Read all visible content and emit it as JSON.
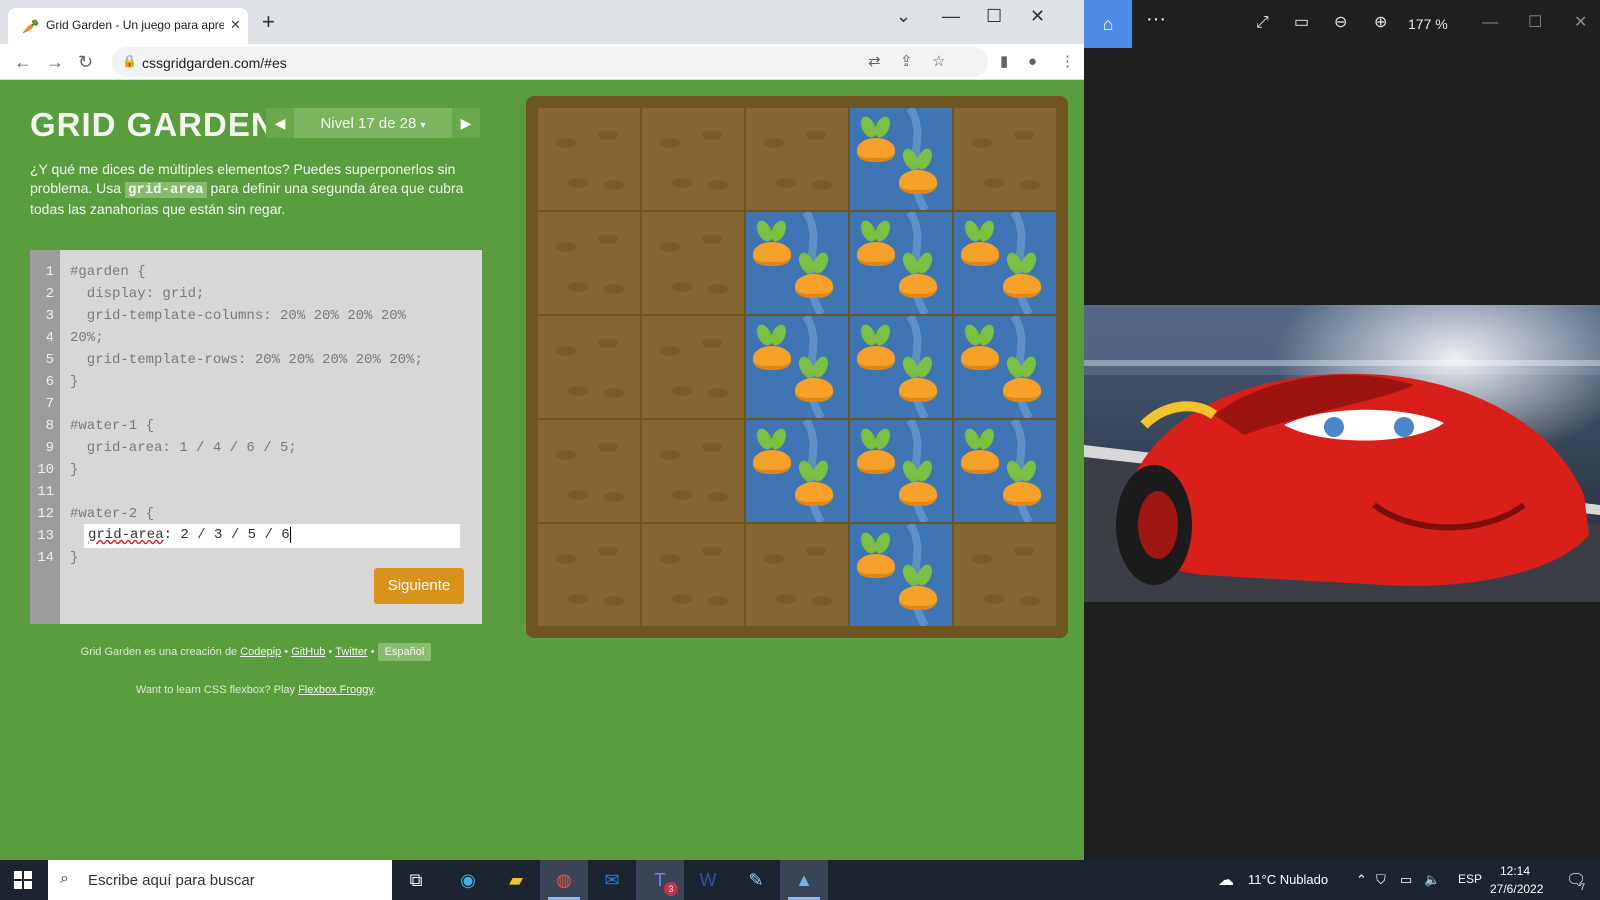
{
  "browser": {
    "tab_title": "Grid Garden - Un juego para aprender CSS grid",
    "tab_favicon": "🥕",
    "url": "cssgridgarden.com/#es"
  },
  "game": {
    "logo": "GRID GARDEN",
    "level_label": "Nivel 17 de 28",
    "instructions_before": "¿Y qué me dices de múltiples elementos? Puedes superponerlos sin problema. Usa ",
    "instructions_code": "grid-area",
    "instructions_after": " para definir una segunda área que cubra todas las zanahorias que están sin regar.",
    "code_lines": [
      "#garden {",
      "  display: grid;",
      "  grid-template-columns: 20% 20% 20% 20%",
      "20%;",
      "  grid-template-rows: 20% 20% 20% 20% 20%;",
      "}",
      "",
      "#water-1 {",
      "  grid-area: 1 / 4 / 6 / 5;",
      "}",
      "",
      "#water-2 {",
      "",
      "}"
    ],
    "line_numbers": [
      "1",
      "2",
      "3",
      "4",
      "5",
      "6",
      "7",
      "8",
      "9",
      "10",
      "11",
      "12",
      "13",
      "14"
    ],
    "answer_property": "grid-area",
    "answer_value": ": 2 / 3 / 5 / 6",
    "next_button": "Siguiente",
    "credits_prefix": "Grid Garden es una creación de ",
    "credits_codepip": "Codepip",
    "credits_github": "GitHub",
    "credits_twitter": "Twitter",
    "credits_language": "Español",
    "flexbox_prefix": "Want to learn CSS flexbox? Play ",
    "flexbox_link": "Flexbox Froggy",
    "flexbox_suffix": ".",
    "water_cells": [
      [
        0,
        3
      ],
      [
        1,
        2
      ],
      [
        1,
        3
      ],
      [
        1,
        4
      ],
      [
        2,
        2
      ],
      [
        2,
        3
      ],
      [
        2,
        4
      ],
      [
        3,
        2
      ],
      [
        3,
        3
      ],
      [
        3,
        4
      ],
      [
        4,
        3
      ]
    ],
    "carrot_cells": [
      [
        0,
        3
      ],
      [
        1,
        2
      ],
      [
        1,
        3
      ],
      [
        1,
        4
      ],
      [
        2,
        2
      ],
      [
        2,
        3
      ],
      [
        2,
        4
      ],
      [
        3,
        2
      ],
      [
        3,
        3
      ],
      [
        3,
        4
      ],
      [
        4,
        3
      ]
    ]
  },
  "photos": {
    "zoom": "177 %"
  },
  "taskbar": {
    "search_placeholder": "Escribe aquí para buscar",
    "weather": "11°C  Nublado",
    "lang": "ESP",
    "time": "12:14",
    "date": "27/6/2022",
    "notifications": "7",
    "teams_badge": "3"
  }
}
